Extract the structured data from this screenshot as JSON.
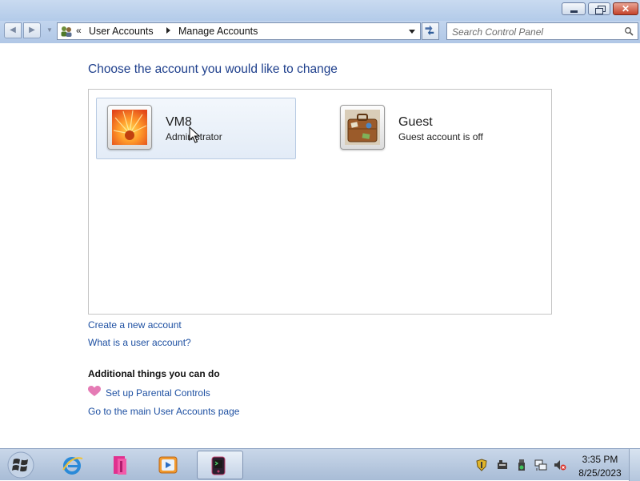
{
  "window": {
    "buttons": {
      "minimize_icon": "minimize-icon",
      "maximize_icon": "restore-icon",
      "close_label": "✕"
    }
  },
  "nav": {
    "back_icon": "back-arrow-icon",
    "forward_icon": "forward-arrow-icon",
    "address": {
      "icon": "user-accounts-icon",
      "overflow": "«",
      "breadcrumbs": [
        "User Accounts",
        "Manage Accounts"
      ]
    },
    "refresh_icon": "refresh-icon",
    "search": {
      "placeholder": "Search Control Panel",
      "value": ""
    }
  },
  "main": {
    "title": "Choose the account you would like to change",
    "accounts": [
      {
        "name": "VM8",
        "subtitle": "Administrator",
        "picture": "orange-flower-picture",
        "selected": true
      },
      {
        "name": "Guest",
        "subtitle": "Guest account is off",
        "picture": "suitcase-picture",
        "selected": false
      }
    ],
    "links": {
      "create": "Create a new account",
      "what_is": "What is a user account?"
    },
    "additional": {
      "heading": "Additional things you can do",
      "parental": "Set up Parental Controls",
      "main_page": "Go to the main User Accounts page"
    }
  },
  "taskbar": {
    "apps": [
      "internet-explorer-icon",
      "library-icon",
      "media-player-icon",
      "terminal-app-icon"
    ],
    "tray_icons": [
      "security-shield-icon",
      "network-drive-icon",
      "usb-icon",
      "network-icon",
      "volume-muted-icon"
    ],
    "clock": {
      "time": "3:35 PM",
      "date": "8/25/2023"
    }
  },
  "colors": {
    "title_blue": "#1e3f8c",
    "link_blue": "#1e50a2",
    "chrome_blue": "#b3cbe9",
    "close_red": "#c4432b"
  }
}
